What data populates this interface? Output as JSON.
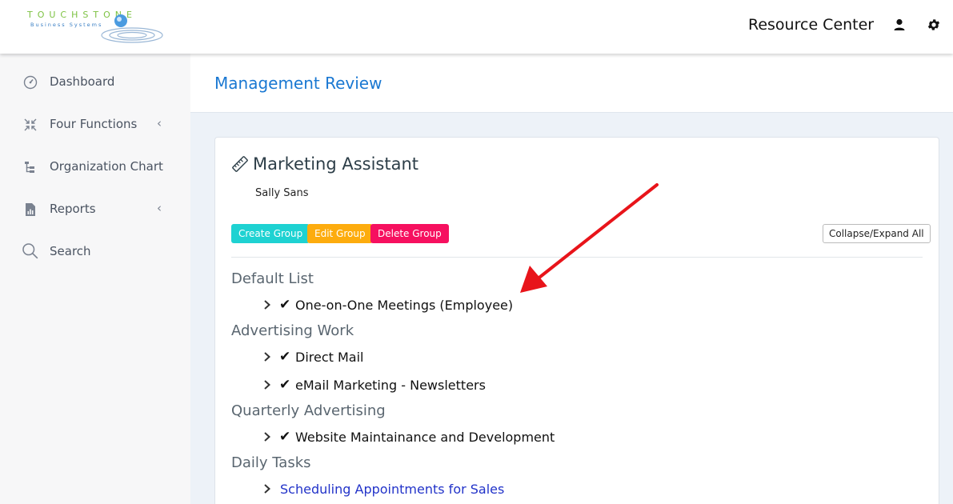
{
  "header": {
    "logo_text": "TOUCHSTONE",
    "logo_subtext": "Business Systems",
    "resource_center": "Resource Center",
    "icons": [
      "user-icon",
      "gear-icon"
    ]
  },
  "sidebar": {
    "items": [
      {
        "label": "Dashboard",
        "icon": "dashboard-gauge-icon",
        "has_submenu": false
      },
      {
        "label": "Four Functions",
        "icon": "compress-arrows-icon",
        "has_submenu": true
      },
      {
        "label": "Organization Chart",
        "icon": "org-chart-icon",
        "has_submenu": false
      },
      {
        "label": "Reports",
        "icon": "report-document-icon",
        "has_submenu": true
      },
      {
        "label": "Search",
        "icon": "search-icon",
        "has_submenu": false
      }
    ]
  },
  "main": {
    "page_title": "Management Review",
    "card": {
      "title": "Marketing Assistant",
      "title_icon": "ruler-icon",
      "subtitle": "Sally Sans",
      "buttons": {
        "create": "Create Group",
        "edit": "Edit Group",
        "delete": "Delete Group",
        "collapse": "Collapse/Expand All"
      },
      "groups": [
        {
          "name": "Default List",
          "items": [
            {
              "label": "One-on-One Meetings (Employee)",
              "checked": true
            }
          ]
        },
        {
          "name": "Advertising Work",
          "items": [
            {
              "label": "Direct Mail",
              "checked": true
            },
            {
              "label": "eMail Marketing - Newsletters",
              "checked": true
            }
          ]
        },
        {
          "name": "Quarterly Advertising",
          "items": [
            {
              "label": "Website Maintainance and Development",
              "checked": true
            }
          ]
        },
        {
          "name": "Daily Tasks",
          "items": [
            {
              "label": "Scheduling Appointments for Sales",
              "checked": false
            }
          ]
        }
      ],
      "check_glyph": "✔"
    }
  },
  "colors": {
    "accent_blue": "#1a78d2",
    "create_btn": "#1ed2d2",
    "edit_btn": "#fdac0e",
    "delete_btn": "#f6105f",
    "annotation_arrow": "#e8141a",
    "link_blue": "#2233c9"
  }
}
